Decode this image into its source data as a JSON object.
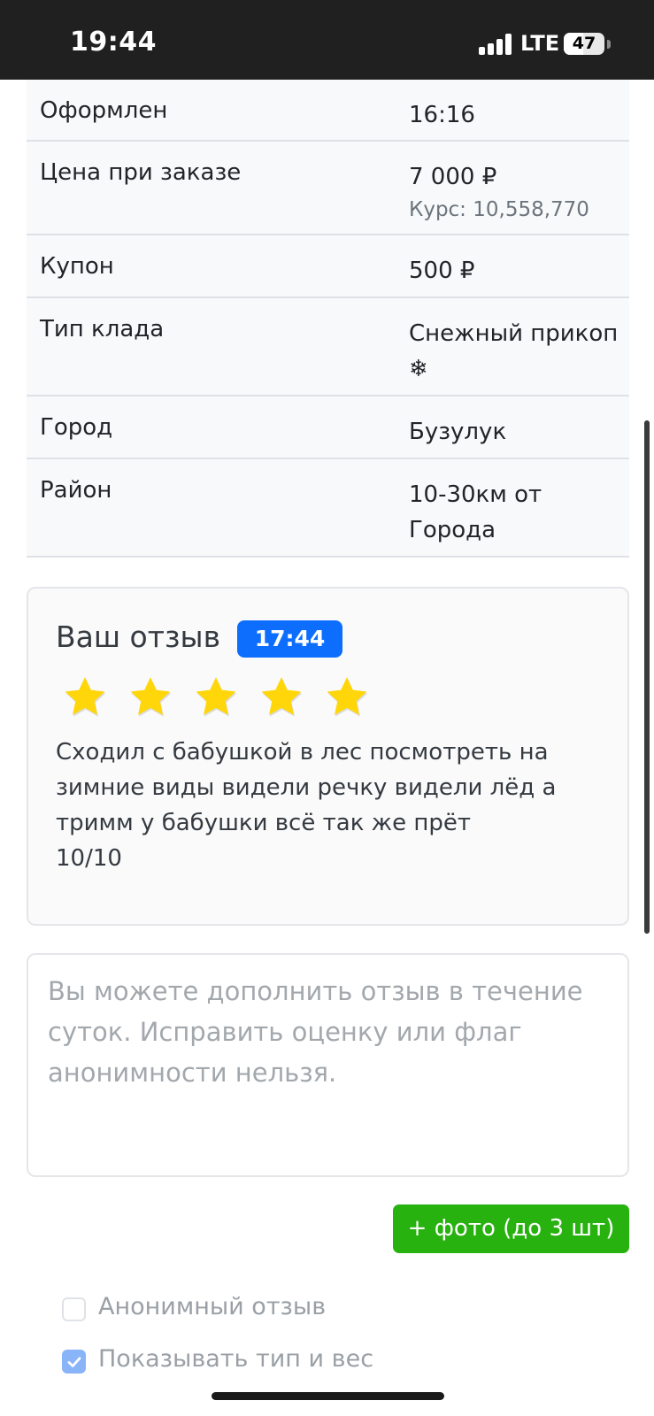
{
  "status_bar": {
    "time": "19:44",
    "network": "LTE",
    "battery": "47",
    "battery_level": 0.47
  },
  "order_details": [
    {
      "label": "Оформлен",
      "value": "16:16",
      "sub": ""
    },
    {
      "label": "Цена при заказе",
      "value": "7 000 ₽",
      "sub": "Курс: 10,558,770"
    },
    {
      "label": "Купон",
      "value": "500 ₽",
      "sub": ""
    },
    {
      "label": "Тип клада",
      "value": "Снежный прикоп ❄",
      "sub": ""
    },
    {
      "label": "Город",
      "value": "Бузулук",
      "sub": ""
    },
    {
      "label": "Район",
      "value": "10-30км от Города",
      "sub": ""
    }
  ],
  "review": {
    "title": "Ваш отзыв",
    "time": "17:44",
    "rating": 5,
    "max_rating": 5,
    "star_color": "#ffd60a",
    "text": "Сходил с бабушкой в лес посмотреть на зимние виды видели речку видели лёд а тримм у бабушки всё так же прёт\n10/10"
  },
  "addendum": {
    "placeholder": "Вы можете дополнить отзыв в течение суток. Исправить оценку или флаг анонимности нельзя.",
    "value": ""
  },
  "photo_button": {
    "label": "+ фото (до 3 шт)",
    "color": "#28b20f"
  },
  "options": {
    "anonymous": {
      "label": "Анонимный отзыв",
      "checked": false
    },
    "show_type_weight": {
      "label": "Показывать тип и вес",
      "checked": true
    }
  }
}
